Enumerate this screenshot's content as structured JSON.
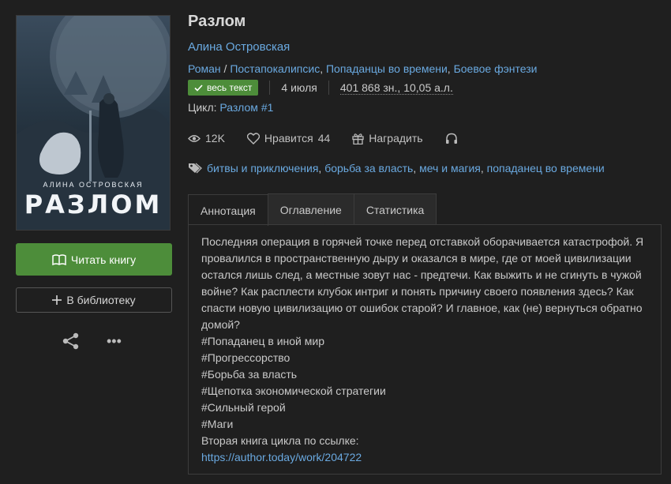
{
  "cover": {
    "author_text": "АЛИНА ОСТРОВСКАЯ",
    "title_text": "РАЗЛОМ"
  },
  "left": {
    "read_label": "Читать книгу",
    "library_label": "В библиотеку",
    "read_icon": "book-icon",
    "library_icon": "plus-icon",
    "share_icon": "share-icon",
    "more_icon": "more-icon",
    "more_text": "•••"
  },
  "book": {
    "title": "Разлом",
    "author": "Алина Островская",
    "genre_main": "Роман",
    "genre_sep": " / ",
    "genres": [
      "Постапокалипсис",
      "Попаданцы во времени",
      "Боевое фэнтези"
    ],
    "badge": "весь текст",
    "date": "4 июля",
    "size": "401 868 зн., 10,05 а.л.",
    "cycle_label": "Цикл:",
    "cycle_name": "Разлом #1"
  },
  "stats": {
    "views": "12K",
    "likes_label": "Нравится",
    "likes_count": "44",
    "reward_label": "Наградить"
  },
  "tags": [
    "битвы и приключения",
    "борьба за власть",
    "меч и магия",
    "попаданец во времени"
  ],
  "tabs": [
    "Аннотация",
    "Оглавление",
    "Статистика"
  ],
  "annotation": {
    "lines": [
      "Последняя операция в горячей точке перед отставкой оборачивается катастрофой. Я провалился в пространственную дыру и оказался в мире, где от моей цивилизации остался лишь след, а местные зовут нас - предтечи. Как выжить и не сгинуть в чужой войне? Как расплести клубок интриг и понять причину своего появления здесь? Как спасти новую цивилизацию от ошибок старой? И главное, как (не) вернуться обратно домой?",
      "#Попаданец в иной мир",
      "#Прогрессорство",
      "#Борьба за власть",
      "#Щепотка экономической стратегии",
      "#Сильный герой",
      "#Маги",
      "Вторая книга цикла по ссылке:"
    ],
    "link": "https://author.today/work/204722"
  },
  "colors": {
    "background": "#1f1f1f",
    "accent_green": "#4d8d3a",
    "link_blue": "#6aa9e0"
  }
}
